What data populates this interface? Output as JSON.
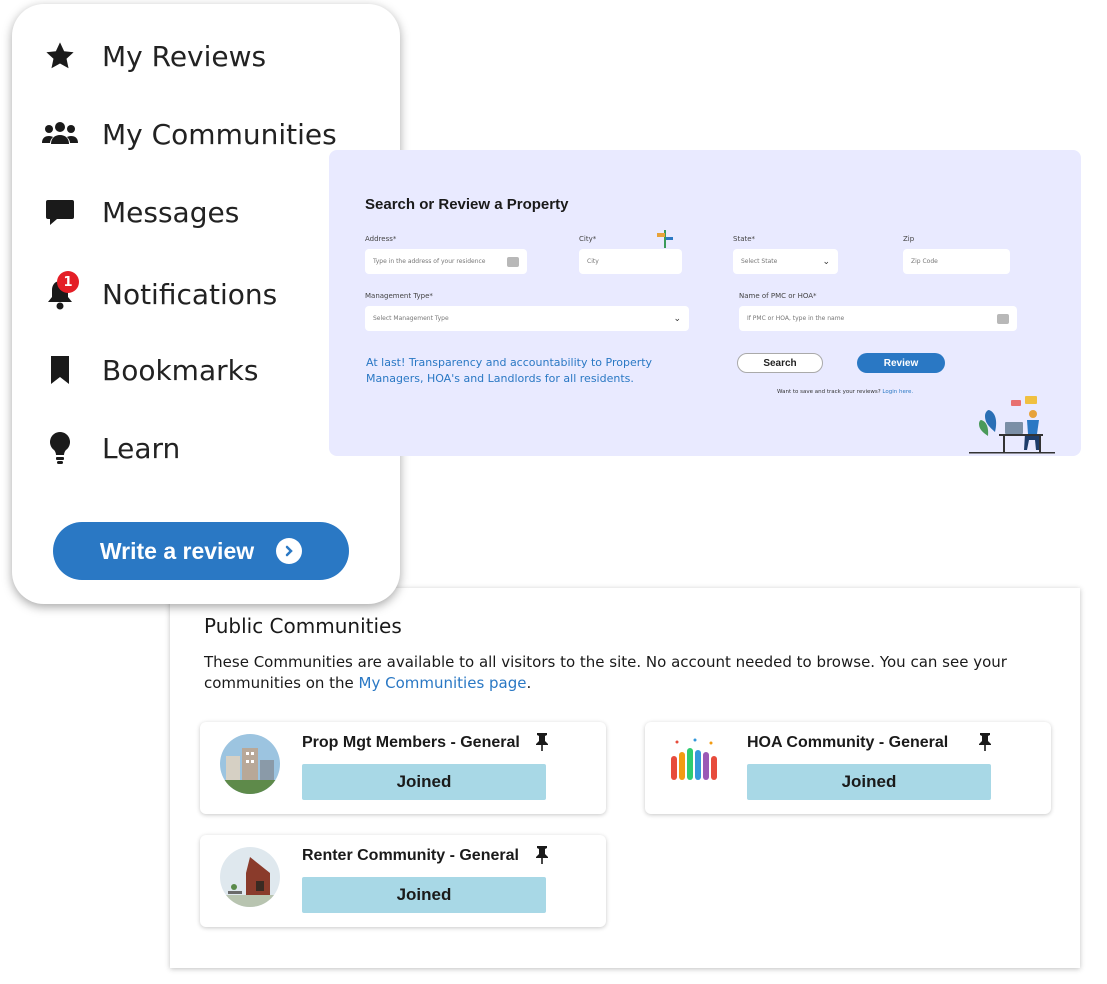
{
  "menu": {
    "items": [
      {
        "label": "My Reviews",
        "icon": "star-icon"
      },
      {
        "label": "My Communities",
        "icon": "users-icon"
      },
      {
        "label": "Messages",
        "icon": "chat-bubble-icon"
      },
      {
        "label": "Notifications",
        "icon": "bell-icon",
        "badge": "1"
      },
      {
        "label": "Bookmarks",
        "icon": "bookmark-icon"
      },
      {
        "label": "Learn",
        "icon": "lightbulb-icon"
      }
    ],
    "write_review_label": "Write a review"
  },
  "search": {
    "title": "Search or Review a Property",
    "address_label": "Address*",
    "address_placeholder": "Type in the address of your residence",
    "city_label": "City*",
    "city_placeholder": "City",
    "state_label": "State*",
    "state_placeholder": "Select State",
    "zip_label": "Zip",
    "zip_placeholder": "Zip Code",
    "mgmt_label": "Management Type*",
    "mgmt_placeholder": "Select Management Type",
    "pmc_label": "Name of PMC or HOA*",
    "pmc_placeholder": "If PMC or HOA, type in the name",
    "tagline": "At last! Transparency and accountability to Property Managers, HOA's and Landlords for all residents.",
    "search_label": "Search",
    "review_label": "Review",
    "login_prompt": "Want to save and track your reviews?",
    "login_link": "Login here."
  },
  "communities": {
    "title": "Public Communities",
    "desc_text": "These Communities are available to all visitors to the site. No account needed to browse. You can see your communities on the ",
    "desc_link": "My Communities page",
    "desc_end": ".",
    "cards": [
      {
        "name": "Prop Mgt Members - General",
        "button": "Joined",
        "pinned": true
      },
      {
        "name": "HOA Community - General",
        "button": "Joined",
        "pinned": true
      },
      {
        "name": "Renter Community - General",
        "button": "Joined",
        "pinned": true
      }
    ]
  },
  "colors": {
    "accent": "#2a78c4",
    "panel_bg": "#e9eaff",
    "joined_bg": "#a8d8e6",
    "badge": "#e41e26"
  }
}
